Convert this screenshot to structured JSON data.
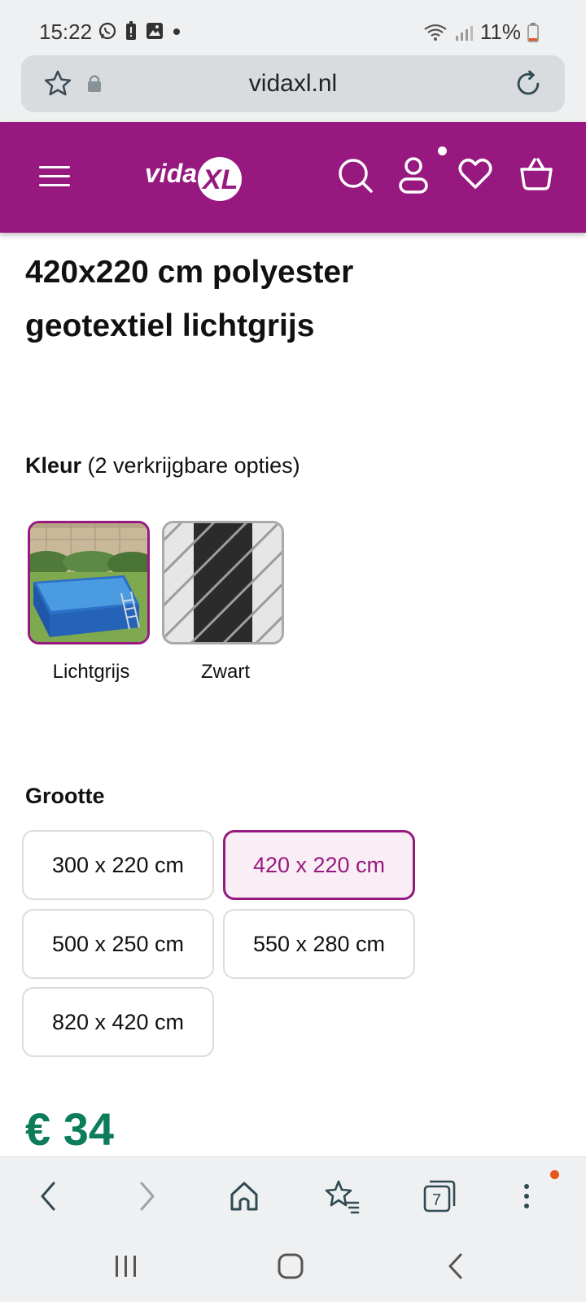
{
  "status_bar": {
    "time": "15:22",
    "battery": "11%"
  },
  "browser": {
    "url": "vidaxl.nl",
    "tabs_count": "7"
  },
  "header": {
    "brand_color": "#97197f",
    "logo_text": "vidaXL",
    "icons": [
      "menu-icon",
      "search-icon",
      "account-icon",
      "heart-icon",
      "basket-icon"
    ]
  },
  "product": {
    "title_line1": "420x220 cm polyester",
    "title_line2": "geotextiel lichtgrijs",
    "color_label": "Kleur",
    "color_options_text": "(2 verkrijgbare opties)",
    "colors": [
      {
        "label": "Lichtgrijs",
        "selected": true
      },
      {
        "label": "Zwart",
        "selected": false
      }
    ],
    "size_label": "Grootte",
    "sizes": [
      {
        "label": "300 x 220 cm",
        "selected": false
      },
      {
        "label": "420 x 220 cm",
        "selected": true
      },
      {
        "label": "500 x 250 cm",
        "selected": false
      },
      {
        "label": "550 x 280 cm",
        "selected": false
      },
      {
        "label": "820 x 420 cm",
        "selected": false
      }
    ],
    "price": "€ 34",
    "price_color": "#0c7c5a"
  }
}
